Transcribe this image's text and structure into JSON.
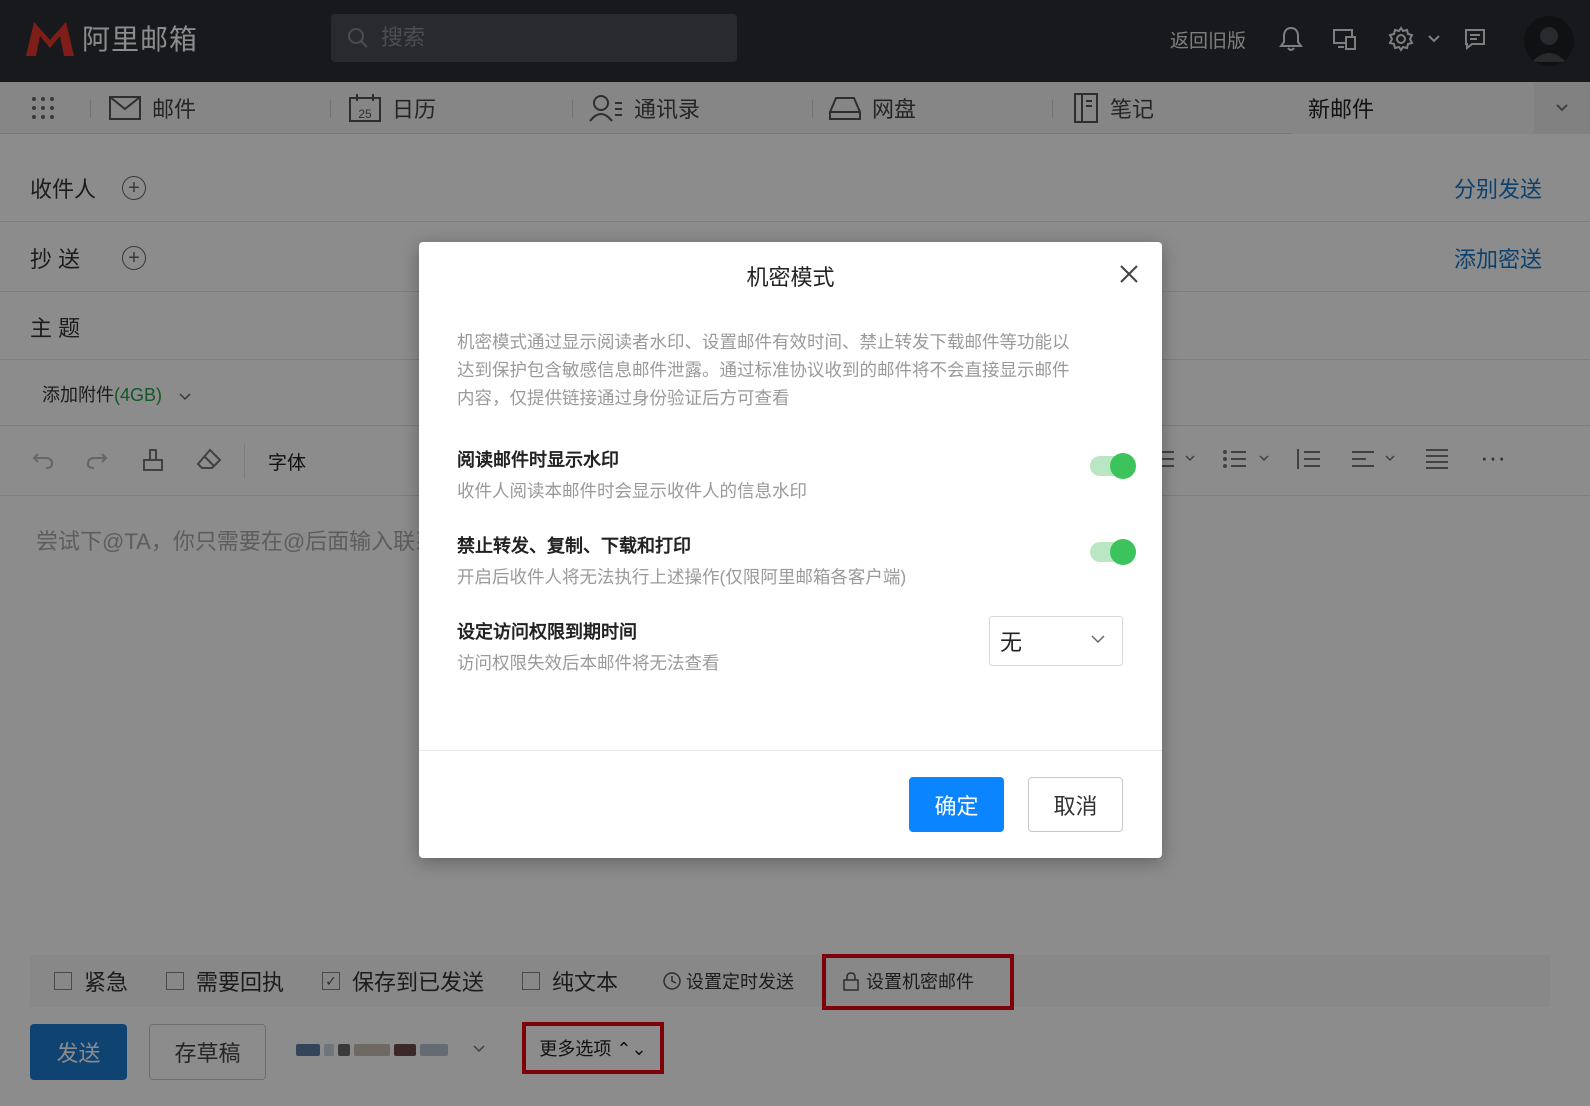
{
  "app": {
    "logo_text": "阿里邮箱",
    "search_placeholder": "搜索",
    "back_old_label": "返回旧版",
    "icons": [
      "bell-icon",
      "devices-icon",
      "gear-icon",
      "chevron-down-icon",
      "feedback-icon",
      "avatar"
    ]
  },
  "nav": {
    "items": [
      {
        "label": "邮件",
        "icon": "mail-icon"
      },
      {
        "label": "日历",
        "icon": "calendar-icon",
        "badge": "25"
      },
      {
        "label": "通讯录",
        "icon": "contacts-icon"
      },
      {
        "label": "网盘",
        "icon": "drive-icon"
      },
      {
        "label": "笔记",
        "icon": "notes-icon"
      }
    ],
    "active_tab": "新邮件"
  },
  "compose": {
    "to_label": "收件人",
    "cc_label": "抄 送",
    "subject_label": "主 题",
    "send_separately": "分别发送",
    "add_bcc": "添加密送",
    "attach_prefix": "添加附件",
    "attach_size": "(4GB)",
    "font_label": "字体",
    "editor_placeholder": "尝试下@TA，你只需要在@后面输入联系"
  },
  "options": {
    "urgent": "紧急",
    "receipt": "需要回执",
    "save_sent": "保存到已发送",
    "plain_text": "纯文本",
    "schedule": "设置定时发送",
    "confidential": "设置机密邮件"
  },
  "footer": {
    "send": "发送",
    "draft": "存草稿",
    "more": "更多选项 ⌃⌄"
  },
  "modal": {
    "title": "机密模式",
    "description": "机密模式通过显示阅读者水印、设置邮件有效时间、禁止转发下载邮件等功能以达到保护包含敏感信息邮件泄露。通过标准协议收到的邮件将不会直接显示邮件内容，仅提供链接通过身份验证后方可查看",
    "watermark_title": "阅读邮件时显示水印",
    "watermark_sub": "收件人阅读本邮件时会显示收件人的信息水印",
    "watermark_enabled": true,
    "forbid_title": "禁止转发、复制、下载和打印",
    "forbid_sub": "开启后收件人将无法执行上述操作(仅限阿里邮箱各客户端)",
    "forbid_enabled": true,
    "expire_title": "设定访问权限到期时间",
    "expire_sub": "访问权限失效后本邮件将无法查看",
    "expire_value": "无",
    "ok": "确定",
    "cancel": "取消"
  },
  "colors": {
    "topbar": "#2b2f36",
    "link": "#1677c8",
    "primary_button": "#0a85ff",
    "toggle_on": "#3cc35c",
    "highlight": "#e60012"
  }
}
